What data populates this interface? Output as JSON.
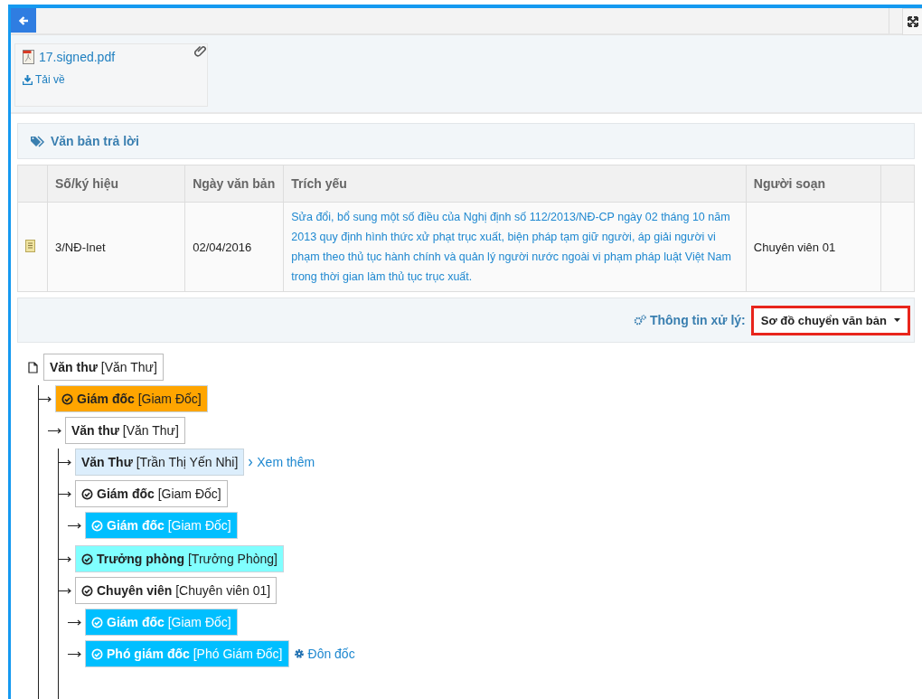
{
  "attachment": {
    "file_name": "17.signed.pdf",
    "download_label": "Tải về"
  },
  "reply_section": {
    "title": "Văn bản trả lời",
    "table": {
      "columns": [
        "Số/ký hiệu",
        "Ngày văn bản",
        "Trích yếu",
        "Người soạn"
      ],
      "rows": [
        {
          "number": "3/NĐ-Inet",
          "date": "02/04/2016",
          "summary": "Sửa đổi, bổ sung một số điều của Nghị định số 112/2013/NĐ-CP ngày 02 tháng 10 năm 2013 quy định hình thức xử phạt trục xuất, biện pháp tạm giữ người, áp giải người vi phạm theo thủ tục hành chính và quản lý người nước ngoài vi phạm pháp luật Việt Nam trong thời gian làm thủ tục trục xuất.",
          "author": "Chuyên viên 01"
        }
      ]
    }
  },
  "processing": {
    "label": "Thông tin xử lý:",
    "dropdown": "Sơ đồ chuyển văn bản"
  },
  "tree": [
    {
      "role": "Văn thư",
      "person": "[Văn Thư]",
      "color": "#ffffff",
      "checked": false,
      "continues": true,
      "children": [
        {
          "role": "Giám đốc",
          "person": "[Giam Đốc]",
          "color": "#ffa500",
          "checked": true,
          "continues": false,
          "children": [
            {
              "role": "Văn thư",
              "person": "[Văn Thư]",
              "color": "#ffffff",
              "checked": false,
              "continues": true,
              "children": [
                {
                  "role": "Văn Thư",
                  "person": "[Trần Thị Yến Nhi]",
                  "color": "#dceefc",
                  "checked": false,
                  "link": "Xem thêm"
                },
                {
                  "role": "Giám đốc",
                  "person": "[Giam Đốc]",
                  "color": "#ffffff",
                  "checked": true,
                  "continues": false,
                  "children": [
                    {
                      "role": "Giám đốc",
                      "person": "[Giam Đốc]",
                      "color": "#00bfff",
                      "checked": true
                    }
                  ]
                },
                {
                  "role": "Trưởng phòng",
                  "person": "[Trưởng Phòng]",
                  "color": "#80ffff",
                  "checked": true
                },
                {
                  "role": "Chuyên viên",
                  "person": "[Chuyên viên 01]",
                  "color": "#ffffff",
                  "checked": true,
                  "continues": false,
                  "children": [
                    {
                      "role": "Giám đốc",
                      "person": "[Giam Đốc]",
                      "color": "#00bfff",
                      "checked": true
                    },
                    {
                      "role": "Phó giám đốc",
                      "person": "[Phó Giám Đốc]",
                      "color": "#00bfff",
                      "checked": true,
                      "action": "Đôn đốc"
                    }
                  ]
                }
              ]
            }
          ]
        }
      ]
    }
  ]
}
